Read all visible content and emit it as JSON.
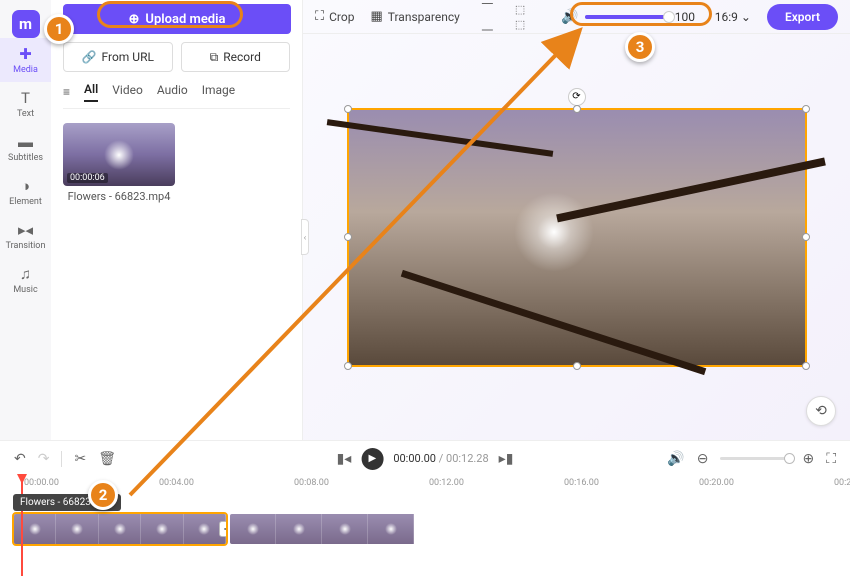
{
  "nav": {
    "items": [
      {
        "label": "Media",
        "icon": "✚"
      },
      {
        "label": "Text",
        "icon": "T"
      },
      {
        "label": "Subtitles",
        "icon": "▬"
      },
      {
        "label": "Element",
        "icon": "◑"
      },
      {
        "label": "Transition",
        "icon": "▸◂"
      },
      {
        "label": "Music",
        "icon": "♫"
      }
    ],
    "active": 0
  },
  "media_panel": {
    "upload_label": "Upload media",
    "from_url_label": "From URL",
    "record_label": "Record",
    "tabs": [
      {
        "label": "All",
        "active": true,
        "icon": "≡"
      },
      {
        "label": "Video"
      },
      {
        "label": "Audio"
      },
      {
        "label": "Image"
      }
    ],
    "thumbnails": [
      {
        "name": "Flowers - 66823.mp4",
        "duration": "00:00:06"
      }
    ]
  },
  "toolbar": {
    "crop_label": "Crop",
    "transparency_label": "Transparency",
    "volume": 100,
    "aspect_ratio": "16:9",
    "export_label": "Export"
  },
  "player": {
    "current_time": "00:00.00",
    "duration": "00:12.28"
  },
  "timeline": {
    "marks": [
      "00:00.00",
      "00:04.00",
      "00:08.00",
      "00:12.00",
      "00:16.00",
      "00:20.00",
      "00:2"
    ],
    "clip_label": "Flowers - 66823.mp4",
    "clips": [
      {
        "selected": true,
        "frames": 5
      },
      {
        "selected": false,
        "frames": 4
      }
    ]
  },
  "annotations": {
    "step1": "1",
    "step2": "2",
    "step3": "3"
  }
}
